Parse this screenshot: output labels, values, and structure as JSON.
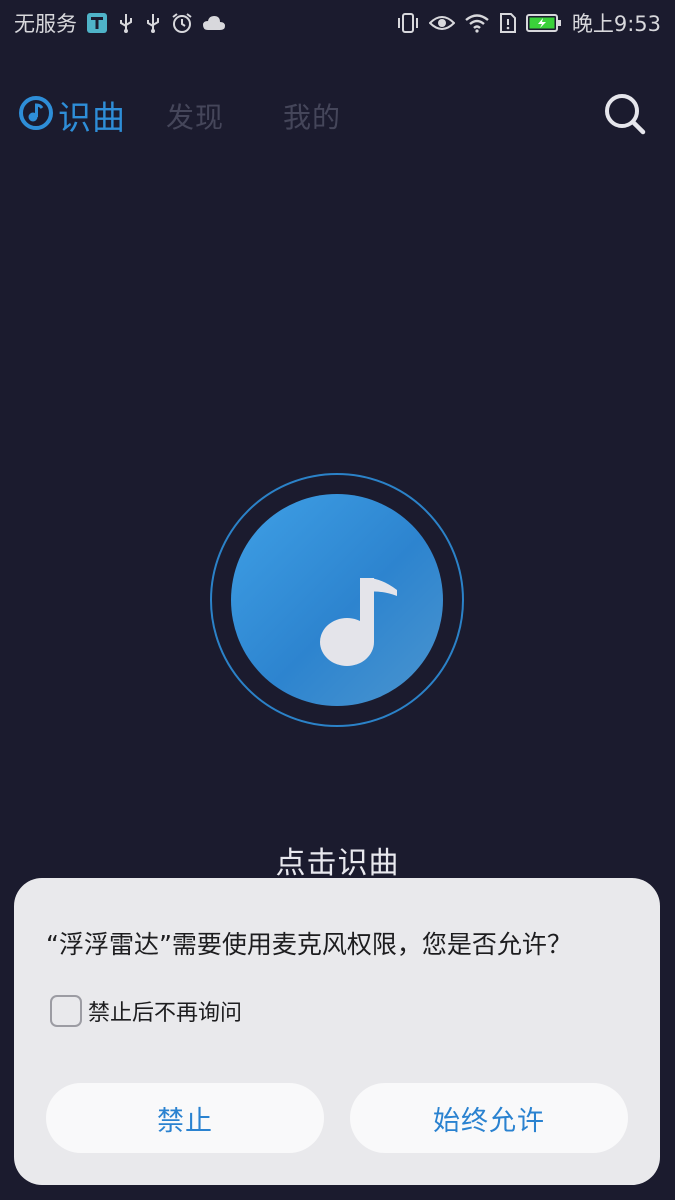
{
  "status_bar": {
    "carrier": "无服务",
    "time": "晚上9:53",
    "left_icons": [
      "sim-card-icon",
      "usb-icon",
      "usb-icon",
      "alarm-icon",
      "cloud-icon"
    ],
    "right_icons": [
      "vibrate-icon",
      "eye-icon",
      "wifi-icon",
      "sim-alert-icon",
      "battery-charging-icon"
    ],
    "battery_color": "#3ad13a"
  },
  "header": {
    "brand": "识曲",
    "tabs": [
      {
        "label": "发现"
      },
      {
        "label": "我的"
      }
    ],
    "search_icon": "search-icon"
  },
  "main": {
    "tap_label": "点击识曲",
    "center_icon": "music-note-icon"
  },
  "dialog": {
    "message": "“浮浮雷达”需要使用麦克风权限，您是否允许？",
    "checkbox_label": "禁止后不再询问",
    "checkbox_checked": false,
    "deny_label": "禁止",
    "allow_label": "始终允许"
  },
  "colors": {
    "background": "#1b1b2e",
    "accent": "#2e8ed8",
    "dialog_background": "#e9e9ec",
    "button_text": "#2a82d0"
  }
}
